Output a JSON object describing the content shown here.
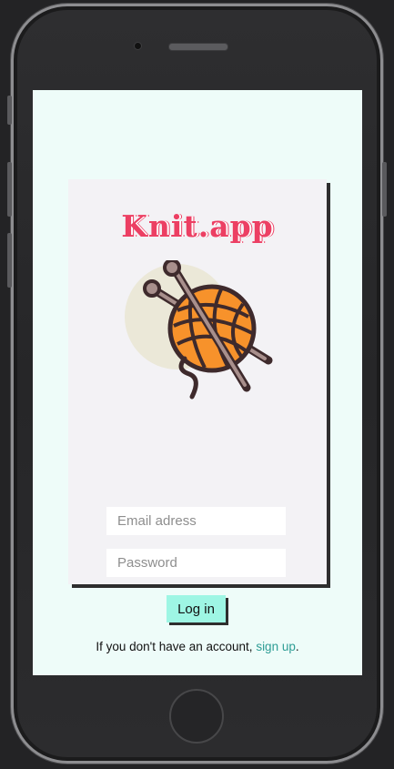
{
  "app": {
    "logo_text": "Knit.app",
    "logo_icon": "yarn-ball-with-knitting-needles-icon"
  },
  "login_form": {
    "email_placeholder": "Email adress",
    "email_value": "",
    "password_placeholder": "Password",
    "password_value": "",
    "login_button_label": "Log in",
    "signup_prefix": "If you don't have an account, ",
    "signup_link_label": "sign up",
    "signup_suffix": "."
  },
  "colors": {
    "screen_background": "#eefcf9",
    "card_background": "#f3f2f5",
    "logo": "#ec3f63",
    "button": "#9ef6e4",
    "link": "#2e9d95",
    "yarn": "#f7922b"
  }
}
